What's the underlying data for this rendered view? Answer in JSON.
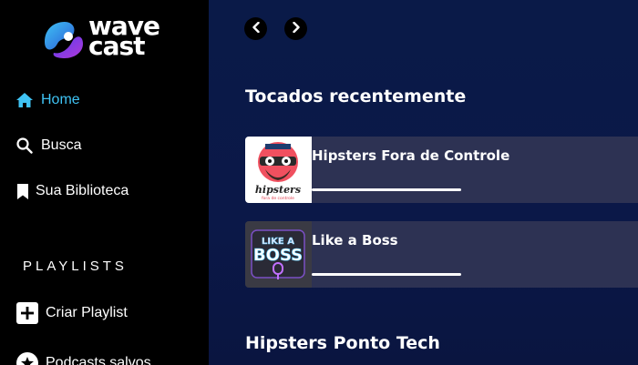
{
  "app": {
    "logo_line1": "wave",
    "logo_line2": "cast"
  },
  "sidebar": {
    "nav": [
      {
        "label": "Home",
        "icon": "home-icon",
        "active": true
      },
      {
        "label": "Busca",
        "icon": "search-icon",
        "active": false
      },
      {
        "label": "Sua Biblioteca",
        "icon": "bookmark-icon",
        "active": false
      }
    ],
    "playlists_title": "PLAYLISTS",
    "actions": [
      {
        "label": "Criar Playlist",
        "icon": "plus-square-icon"
      },
      {
        "label": "Podcasts salvos",
        "icon": "star-circle-icon"
      }
    ]
  },
  "main": {
    "recent_title": "Tocados recentemente",
    "recent": [
      {
        "title": "Hipsters Fora de Controle",
        "thumb_text": "hipsters",
        "thumb_subtext": "fora de controle",
        "progress": 1.0
      },
      {
        "title": "Like a Boss",
        "thumb_text_1": "LIKE A",
        "thumb_text_2": "BOSS",
        "progress": 1.0
      }
    ],
    "next_section_title": "Hipsters Ponto Tech"
  },
  "colors": {
    "accent": "#3fc3f4",
    "sidebar_bg": "#000000",
    "card_bg": "#2d3253"
  }
}
